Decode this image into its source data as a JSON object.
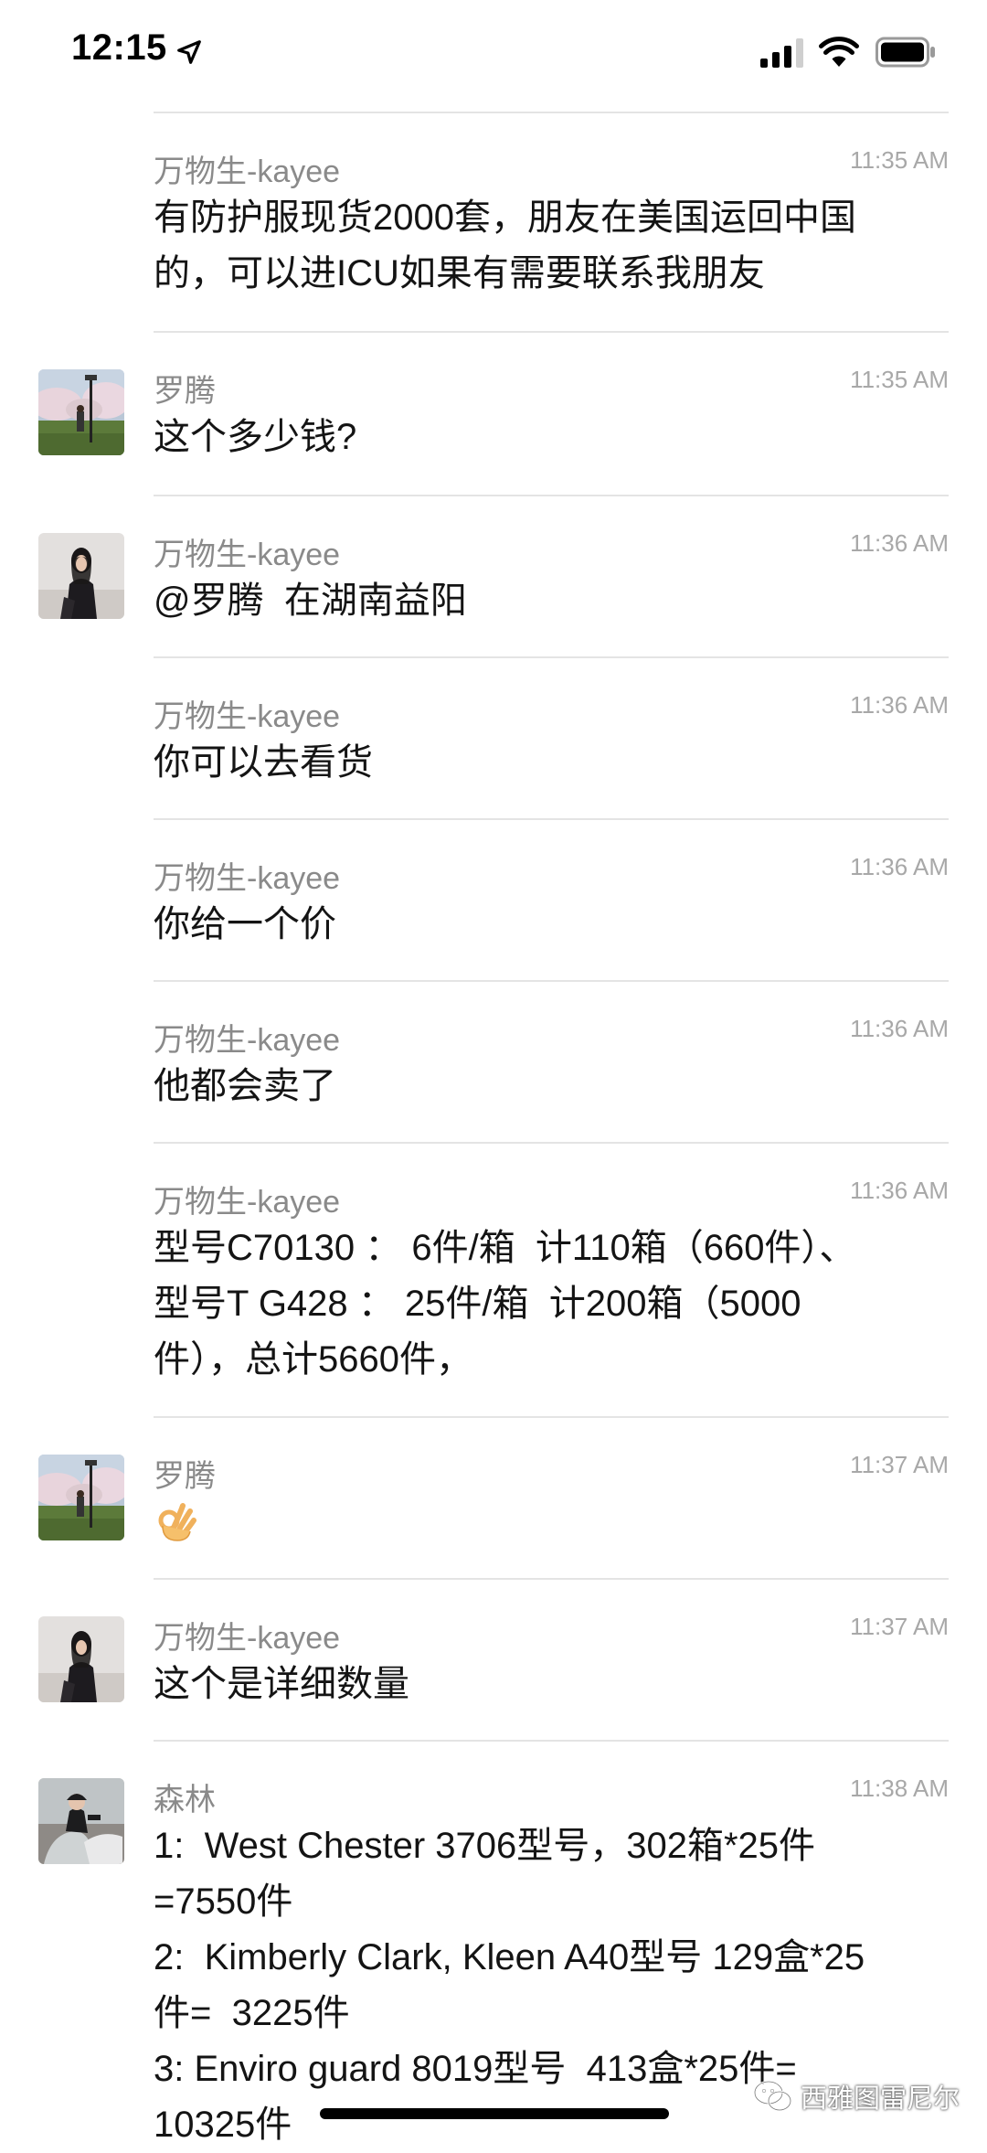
{
  "status_bar": {
    "time": "12:15",
    "location_icon": "location-arrow-icon",
    "signal_icon": "cellular-signal-icon",
    "wifi_icon": "wifi-icon",
    "battery_icon": "battery-icon"
  },
  "messages": [
    {
      "sender": "万物生-kayee",
      "time": "11:35 AM",
      "text": "有防护服现货2000套，朋友在美国运回中国\n的，可以进ICU如果有需要联系我朋友"
    },
    {
      "sender": "罗腾",
      "time": "11:35 AM",
      "text": "这个多少钱?"
    },
    {
      "sender": "万物生-kayee",
      "time": "11:36 AM",
      "text": "@罗腾  在湖南益阳"
    },
    {
      "sender": "万物生-kayee",
      "time": "11:36 AM",
      "text": "你可以去看货"
    },
    {
      "sender": "万物生-kayee",
      "time": "11:36 AM",
      "text": "你给一个价"
    },
    {
      "sender": "万物生-kayee",
      "time": "11:36 AM",
      "text": "他都会卖了"
    },
    {
      "sender": "万物生-kayee",
      "time": "11:36 AM",
      "text": "型号C70130 ： 6件/箱  计110箱（660件）、\n型号T G428 ： 25件/箱  计200箱（5000\n件），总计5660件，"
    },
    {
      "sender": "罗腾",
      "time": "11:37 AM",
      "emoji": "ok-hand-emoji"
    },
    {
      "sender": "万物生-kayee",
      "time": "11:37 AM",
      "text": "这个是详细数量"
    },
    {
      "sender": "森林",
      "time": "11:38 AM",
      "text": "1:  West Chester 3706型号，302箱*25件\n=7550件\n2:  Kimberly Clark, Kleen A40型号 129盒*25\n件=  3225件\n3: Enviro guard 8019型号  413盒*25件=\n10325件"
    }
  ],
  "watermark": {
    "text": "西雅图雷尼尔",
    "icon": "wechat-icon"
  },
  "colors": {
    "divider": "#e4e4e4",
    "sender": "#8a8a8a",
    "timestamp": "#a8a8a8",
    "text": "#141414"
  }
}
